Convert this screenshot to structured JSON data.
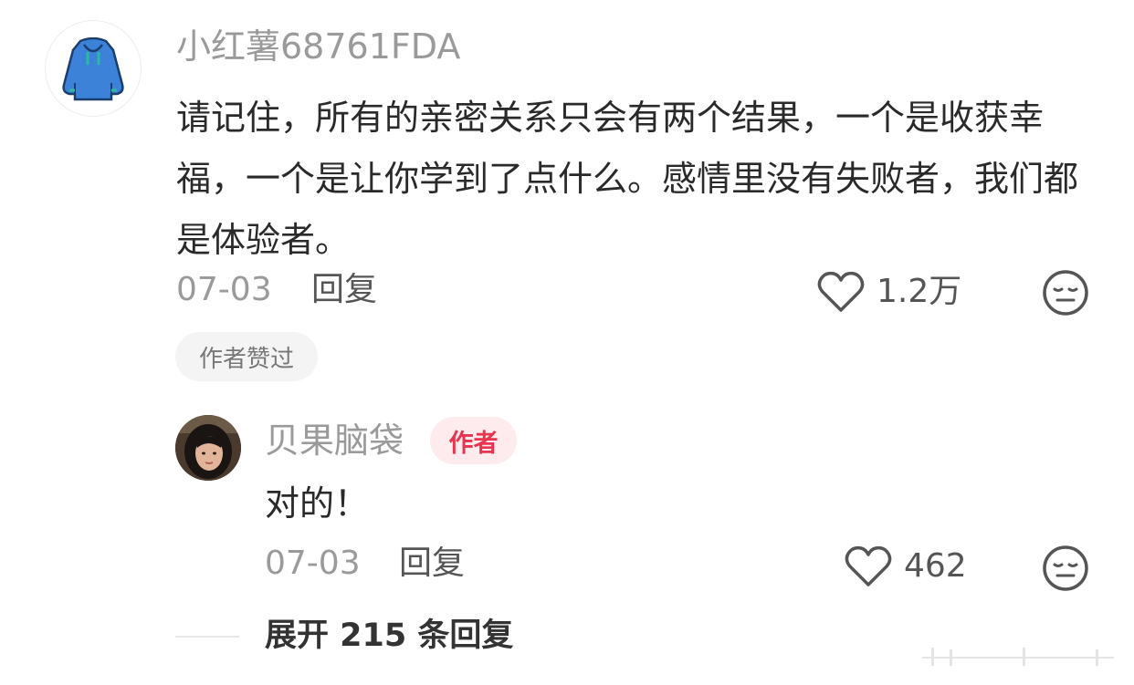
{
  "comment": {
    "username": "小红薯68761FDA",
    "avatar_icon": "hoodie-icon",
    "text": "请记住，所有的亲密关系只会有两个结果，一个是收获幸福，一个是让你学到了点什么。感情里没有失败者，我们都是体验者。",
    "date": "07-03",
    "reply_label": "回复",
    "like_count": "1.2万",
    "liked_by_author": "作者赞过"
  },
  "reply": {
    "username": "贝果脑袋",
    "author_badge": "作者",
    "text": "对的！",
    "date": "07-03",
    "reply_label": "回复",
    "like_count": "462"
  },
  "expand_replies": "展开 215 条回复",
  "colors": {
    "accent": "#e8344e",
    "badge_bg": "#fdebee",
    "muted_text": "#9a9a9a",
    "avatar_hoodie": "#3b82d8"
  }
}
